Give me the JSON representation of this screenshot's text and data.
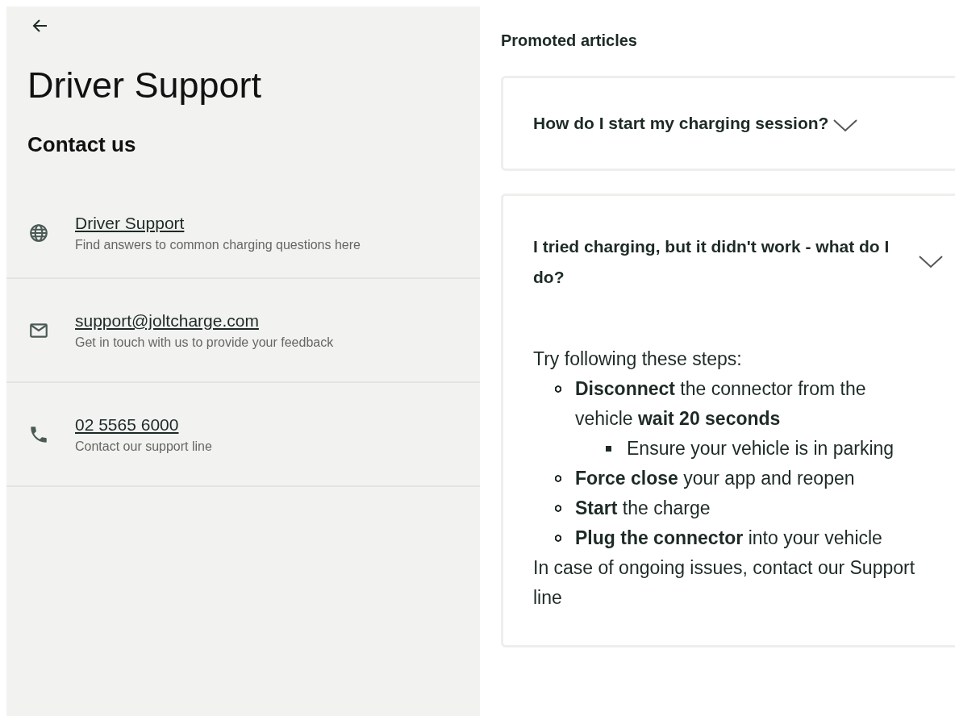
{
  "header": {
    "title": "Driver Support"
  },
  "contact": {
    "heading": "Contact us",
    "items": [
      {
        "kind": "web",
        "link": "Driver Support",
        "description": "Find answers to common charging questions here"
      },
      {
        "kind": "email",
        "link": "support@joltcharge.com",
        "description": "Get in touch with us to provide your feedback"
      },
      {
        "kind": "phone",
        "link": "02 5565 6000",
        "description": "Contact our support line"
      }
    ]
  },
  "promoted": {
    "heading": "Promoted articles",
    "articles": [
      {
        "title": "How do I start my charging session?",
        "expanded": false
      },
      {
        "title": "I tried charging, but it didn't work - what do I do?",
        "expanded": true,
        "body": {
          "intro": "Try following these steps:",
          "steps": [
            {
              "text": "**Disconnect** the connector from the vehicle **wait 20 seconds**",
              "children": [
                {
                  "text": "Ensure your vehicle is in parking"
                }
              ]
            },
            {
              "text": "**Force close** your app and reopen"
            },
            {
              "text": "**Start** the charge"
            },
            {
              "text": "**Plug the connector** into your vehicle"
            }
          ],
          "outro": "In case of ongoing issues, contact our Support line"
        }
      }
    ]
  }
}
